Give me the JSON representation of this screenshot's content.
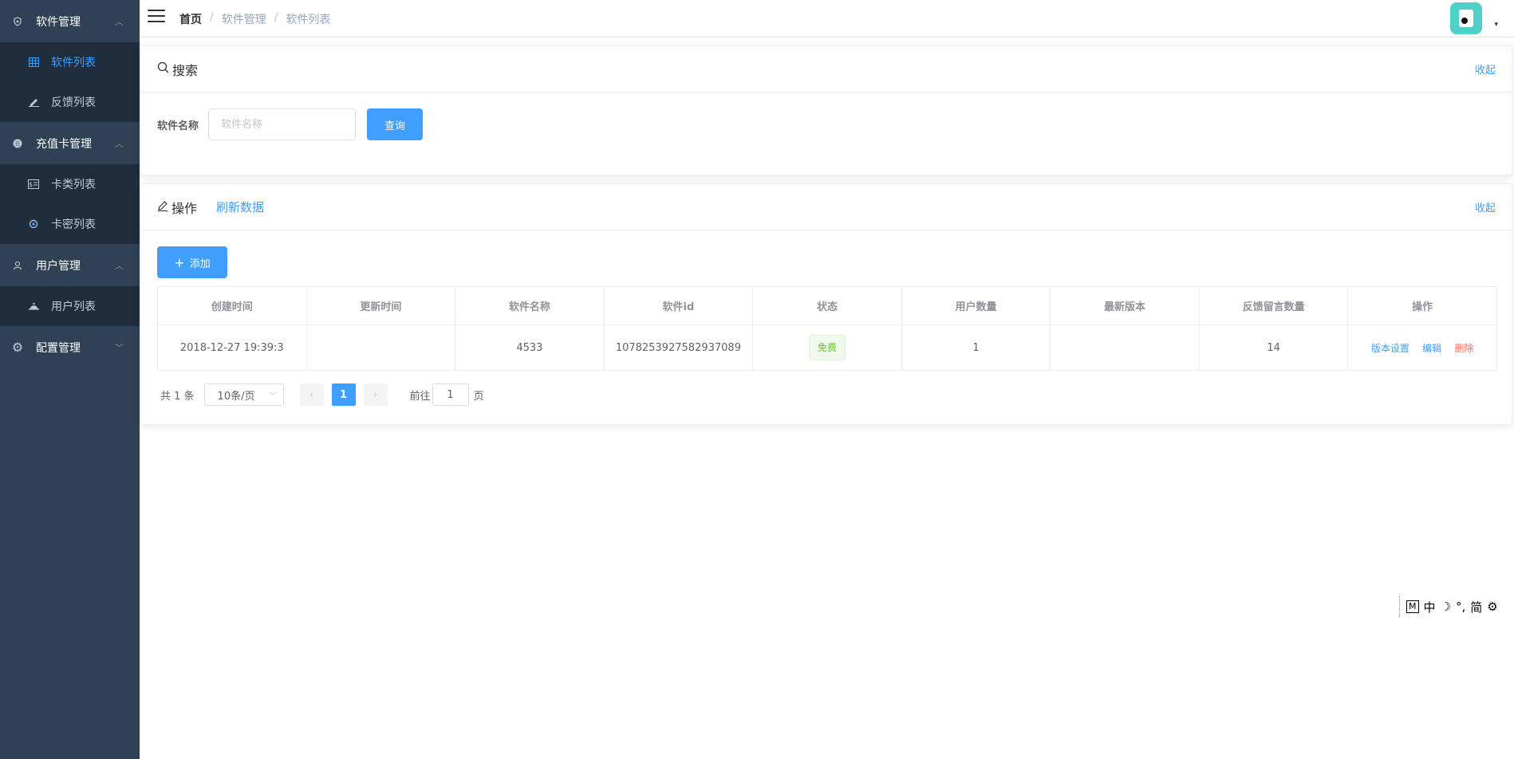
{
  "sidebar": {
    "groups": [
      {
        "label": "软件管理",
        "icon": "shield-icon",
        "arrow": "︿",
        "items": [
          {
            "label": "软件列表",
            "icon": "table-icon",
            "active": true
          },
          {
            "label": "反馈列表",
            "icon": "edit-icon",
            "active": false
          }
        ]
      },
      {
        "label": "充值卡管理",
        "icon": "coin-icon",
        "arrow": "︿",
        "items": [
          {
            "label": "卡类列表",
            "icon": "card-icon",
            "active": false
          },
          {
            "label": "卡密列表",
            "icon": "key-icon",
            "active": false
          }
        ]
      },
      {
        "label": "用户管理",
        "icon": "user-icon",
        "arrow": "︿",
        "items": [
          {
            "label": "用户列表",
            "icon": "users-icon",
            "active": false
          }
        ]
      },
      {
        "label": "配置管理",
        "icon": "gear-icon",
        "arrow": "﹀",
        "items": []
      }
    ]
  },
  "header": {
    "breadcrumb": {
      "home": "首页",
      "level1": "软件管理",
      "level2": "软件列表",
      "sep": "/"
    },
    "avatar_caret": "▾"
  },
  "search": {
    "title": "搜索",
    "collapse_label": "收起",
    "field_label": "软件名称",
    "placeholder": "软件名称",
    "value": "",
    "query_button": "查询"
  },
  "operations": {
    "title": "操作",
    "refresh_label": "刷新数据",
    "collapse_label": "收起",
    "add_button": "添加"
  },
  "table": {
    "columns": [
      "创建时间",
      "更新时间",
      "软件名称",
      "软件id",
      "状态",
      "用户数量",
      "最新版本",
      "反馈留言数量",
      "操作"
    ],
    "rows": [
      {
        "created": "2018-12-27 19:39:3",
        "updated": "",
        "name": "4533",
        "id": "1078253927582937089",
        "status": "免费",
        "user_count": "1",
        "latest_version": "",
        "feedback_count": "14",
        "actions": {
          "version": "版本设置",
          "edit": "编辑",
          "delete": "删除"
        }
      }
    ]
  },
  "pagination": {
    "total_label": "共 1 条",
    "page_size": "10条/页",
    "prev": "‹",
    "next": "›",
    "current_page": "1",
    "goto_prefix": "前往",
    "goto_value": "1",
    "goto_suffix": "页"
  },
  "ime_bar": {
    "mode": "M",
    "lang": "中",
    "moon": "☽",
    "punct": "°,",
    "simplified": "简",
    "settings": "⚙"
  },
  "colors": {
    "sidebar_bg": "#304156",
    "submenu_bg": "#1f2d3d",
    "primary": "#409eff",
    "danger": "#f56c6c",
    "success": "#67c23a"
  }
}
